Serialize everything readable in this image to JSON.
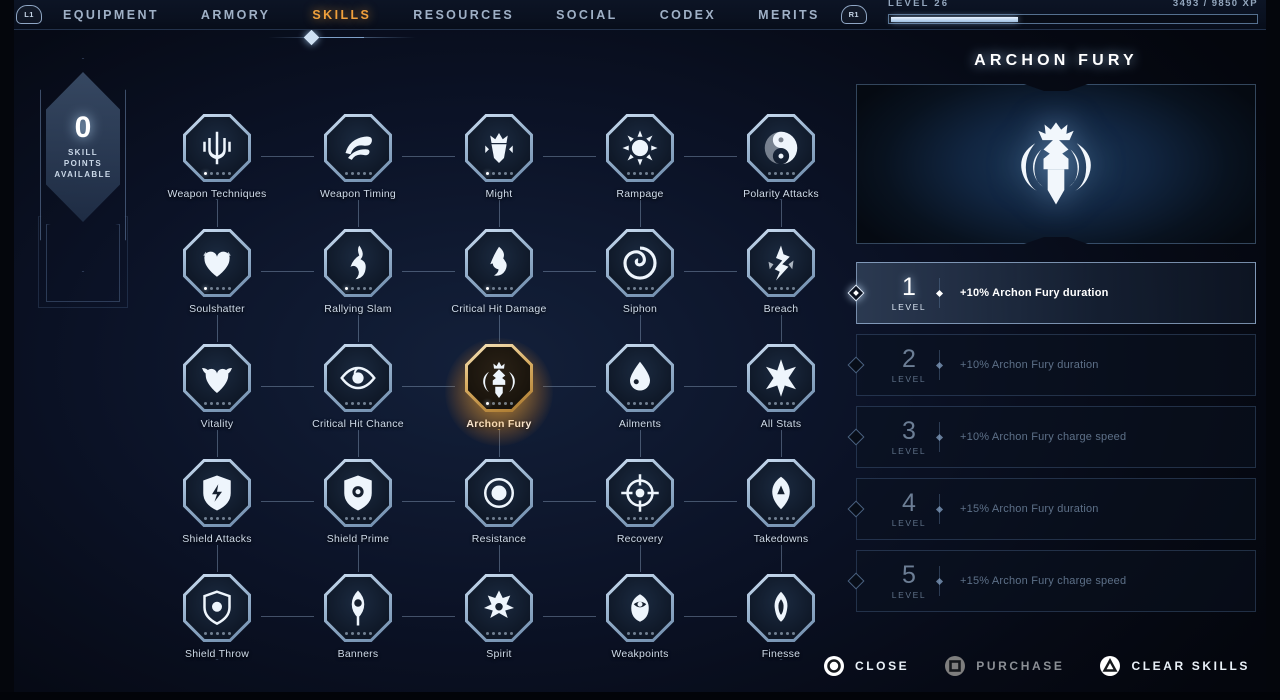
{
  "nav": {
    "left_shoulder": "L1",
    "right_shoulder": "R1",
    "items": [
      {
        "label": "EQUIPMENT",
        "active": false
      },
      {
        "label": "ARMORY",
        "active": false
      },
      {
        "label": "SKILLS",
        "active": true
      },
      {
        "label": "RESOURCES",
        "active": false
      },
      {
        "label": "SOCIAL",
        "active": false
      },
      {
        "label": "CODEX",
        "active": false
      },
      {
        "label": "MERITS",
        "active": false
      }
    ]
  },
  "xp": {
    "level_label": "LEVEL 26",
    "value_label": "3493 / 9850 XP",
    "percent": 35
  },
  "skill_points": {
    "count": "0",
    "label_line1": "SKILL",
    "label_line2": "POINTS",
    "label_line3": "AVAILABLE"
  },
  "tree": {
    "nodes": [
      {
        "label": "Weapon Techniques",
        "icon": "trident-icon",
        "row": 0,
        "col": 0,
        "major": true,
        "pips": 5,
        "filled": 1,
        "selected": false
      },
      {
        "label": "Weapon Timing",
        "icon": "swirl-blade-icon",
        "row": 0,
        "col": 1,
        "major": false,
        "pips": 5,
        "filled": 0,
        "selected": false
      },
      {
        "label": "Might",
        "icon": "crown-beast-icon",
        "row": 0,
        "col": 2,
        "major": false,
        "pips": 5,
        "filled": 1,
        "selected": false
      },
      {
        "label": "Rampage",
        "icon": "fist-burst-icon",
        "row": 0,
        "col": 3,
        "major": false,
        "pips": 5,
        "filled": 0,
        "selected": false
      },
      {
        "label": "Polarity Attacks",
        "icon": "yinyang-icon",
        "row": 0,
        "col": 4,
        "major": true,
        "pips": 5,
        "filled": 0,
        "selected": false
      },
      {
        "label": "Soulshatter",
        "icon": "heart-shard-icon",
        "row": 1,
        "col": 0,
        "major": false,
        "pips": 5,
        "filled": 1,
        "selected": false
      },
      {
        "label": "Rallying Slam",
        "icon": "flame-spiral-icon",
        "row": 1,
        "col": 1,
        "major": false,
        "pips": 5,
        "filled": 1,
        "selected": false
      },
      {
        "label": "Critical Hit Damage",
        "icon": "crit-flame-icon",
        "row": 1,
        "col": 2,
        "major": false,
        "pips": 5,
        "filled": 1,
        "selected": false
      },
      {
        "label": "Siphon",
        "icon": "spiral-drain-icon",
        "row": 1,
        "col": 3,
        "major": false,
        "pips": 5,
        "filled": 0,
        "selected": false
      },
      {
        "label": "Breach",
        "icon": "crack-icon",
        "row": 1,
        "col": 4,
        "major": false,
        "pips": 5,
        "filled": 0,
        "selected": false
      },
      {
        "label": "Vitality",
        "icon": "leaf-heart-icon",
        "row": 2,
        "col": 0,
        "major": false,
        "pips": 5,
        "filled": 0,
        "selected": false
      },
      {
        "label": "Critical Hit Chance",
        "icon": "eye-swirl-icon",
        "row": 2,
        "col": 1,
        "major": false,
        "pips": 5,
        "filled": 0,
        "selected": false
      },
      {
        "label": "Archon Fury",
        "icon": "archon-fury-icon",
        "row": 2,
        "col": 2,
        "major": true,
        "pips": 5,
        "filled": 1,
        "selected": true
      },
      {
        "label": "Ailments",
        "icon": "droplet-icon",
        "row": 2,
        "col": 3,
        "major": false,
        "pips": 5,
        "filled": 0,
        "selected": false
      },
      {
        "label": "All Stats",
        "icon": "starburst-icon",
        "row": 2,
        "col": 4,
        "major": false,
        "pips": 5,
        "filled": 0,
        "selected": false
      },
      {
        "label": "Shield Attacks",
        "icon": "shield-strike-icon",
        "row": 3,
        "col": 0,
        "major": false,
        "pips": 5,
        "filled": 0,
        "selected": false
      },
      {
        "label": "Shield Prime",
        "icon": "shield-swirl-icon",
        "row": 3,
        "col": 1,
        "major": false,
        "pips": 5,
        "filled": 0,
        "selected": false
      },
      {
        "label": "Resistance",
        "icon": "ward-icon",
        "row": 3,
        "col": 2,
        "major": false,
        "pips": 5,
        "filled": 0,
        "selected": false
      },
      {
        "label": "Recovery",
        "icon": "target-cross-icon",
        "row": 3,
        "col": 3,
        "major": false,
        "pips": 5,
        "filled": 0,
        "selected": false
      },
      {
        "label": "Takedowns",
        "icon": "fang-icon",
        "row": 3,
        "col": 4,
        "major": false,
        "pips": 5,
        "filled": 0,
        "selected": false
      },
      {
        "label": "Shield Throw",
        "icon": "shield-throw-icon",
        "row": 4,
        "col": 0,
        "major": true,
        "pips": 5,
        "filled": 0,
        "selected": false
      },
      {
        "label": "Banners",
        "icon": "banner-icon",
        "row": 4,
        "col": 1,
        "major": false,
        "pips": 5,
        "filled": 0,
        "selected": false
      },
      {
        "label": "Spirit",
        "icon": "spirit-icon",
        "row": 4,
        "col": 2,
        "major": false,
        "pips": 5,
        "filled": 0,
        "selected": false
      },
      {
        "label": "Weakpoints",
        "icon": "weakpoint-icon",
        "row": 4,
        "col": 3,
        "major": false,
        "pips": 5,
        "filled": 0,
        "selected": false
      },
      {
        "label": "Finesse",
        "icon": "finesse-icon",
        "row": 4,
        "col": 4,
        "major": true,
        "pips": 5,
        "filled": 0,
        "selected": false
      }
    ]
  },
  "detail": {
    "title": "ARCHON FURY",
    "hero_icon": "archon-fury-crest-icon",
    "level_word": "LEVEL",
    "levels": [
      {
        "number": "1",
        "desc": "+10% Archon Fury duration",
        "active": true
      },
      {
        "number": "2",
        "desc": "+10% Archon Fury duration",
        "active": false
      },
      {
        "number": "3",
        "desc": "+10% Archon Fury charge speed",
        "active": false
      },
      {
        "number": "4",
        "desc": "+15% Archon Fury duration",
        "active": false
      },
      {
        "number": "5",
        "desc": "+15% Archon Fury charge speed",
        "active": false
      }
    ]
  },
  "actions": [
    {
      "label": "CLOSE",
      "button": "circle",
      "dim": false
    },
    {
      "label": "PURCHASE",
      "button": "square",
      "dim": true
    },
    {
      "label": "CLEAR SKILLS",
      "button": "triangle",
      "dim": false
    }
  ],
  "colors": {
    "accent": "#f0a03c",
    "panel_border": "#5f82af",
    "text_primary": "#ffffff",
    "text_muted": "#5d7088",
    "background": "#0b1226"
  }
}
